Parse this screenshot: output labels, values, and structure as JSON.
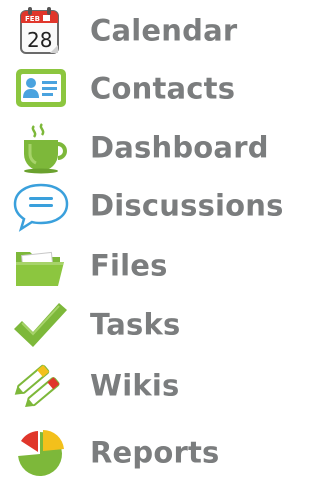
{
  "nav": {
    "items": [
      {
        "label": "Calendar",
        "icon": "calendar-icon"
      },
      {
        "label": "Contacts",
        "icon": "contact-card-icon"
      },
      {
        "label": "Dashboard",
        "icon": "coffee-cup-icon"
      },
      {
        "label": "Discussions",
        "icon": "speech-bubble-icon"
      },
      {
        "label": "Files",
        "icon": "folder-icon"
      },
      {
        "label": "Tasks",
        "icon": "checkmark-icon"
      },
      {
        "label": "Wikis",
        "icon": "pencils-icon"
      },
      {
        "label": "Reports",
        "icon": "pie-chart-icon"
      }
    ],
    "calendar_icon": {
      "month": "FEB",
      "day": "28"
    }
  },
  "colors": {
    "label_gray": "#7b7d7e",
    "brand_green": "#7db83a",
    "accent_red": "#e0362b",
    "accent_blue": "#4aa3df",
    "accent_yellow": "#f3c01b"
  }
}
